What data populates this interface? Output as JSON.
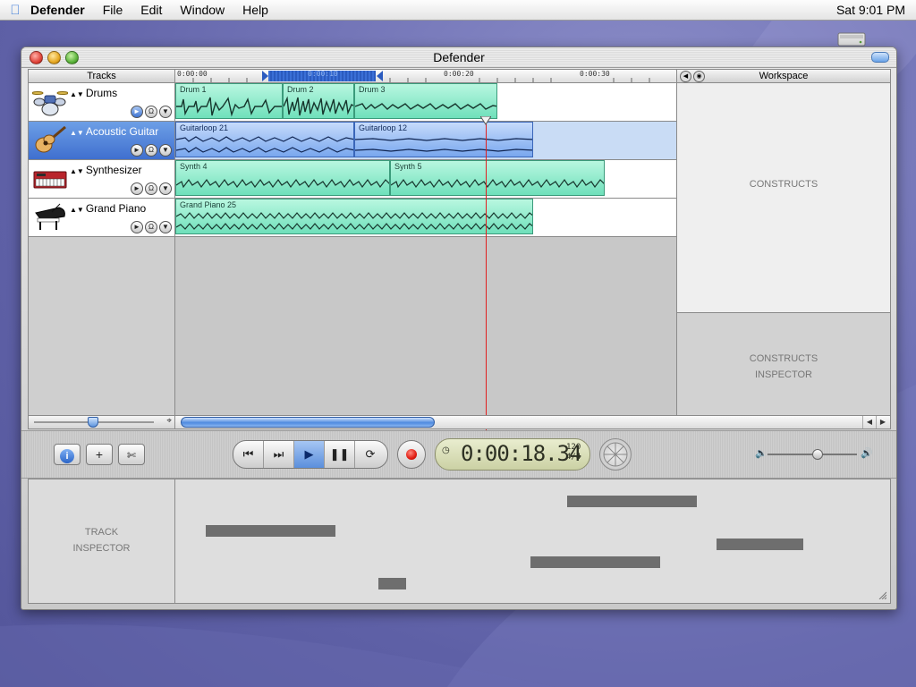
{
  "menubar": {
    "app_name": "Defender",
    "items": [
      "File",
      "Edit",
      "Window",
      "Help"
    ],
    "clock": "Sat 9:01 PM"
  },
  "window": {
    "title": "Defender"
  },
  "tracks_panel": {
    "header": "Tracks",
    "tracks": [
      {
        "name": "Drums",
        "icon": "drum-kit-icon",
        "selected": false
      },
      {
        "name": "Acoustic Guitar",
        "icon": "guitar-icon",
        "selected": true
      },
      {
        "name": "Synthesizer",
        "icon": "keyboard-synth-icon",
        "selected": false
      },
      {
        "name": "Grand Piano",
        "icon": "grand-piano-icon",
        "selected": false
      }
    ]
  },
  "timeline": {
    "ruler_labels": [
      "0:00:00",
      "0:00:10",
      "0:00:20",
      "0:00:30"
    ],
    "regions": [
      {
        "track": 0,
        "label": "Drum 1",
        "color": "green"
      },
      {
        "track": 0,
        "label": "Drum 2",
        "color": "green"
      },
      {
        "track": 0,
        "label": "Drum 3",
        "color": "green"
      },
      {
        "track": 1,
        "label": "Guitarloop 21",
        "color": "blue"
      },
      {
        "track": 1,
        "label": "Guitarloop 12",
        "color": "blue"
      },
      {
        "track": 2,
        "label": "Synth 4",
        "color": "green"
      },
      {
        "track": 2,
        "label": "Synth 5",
        "color": "green"
      },
      {
        "track": 3,
        "label": "Grand Piano 25",
        "color": "green"
      }
    ]
  },
  "workspace": {
    "header": "Workspace",
    "constructs_label": "CONSTRUCTS",
    "constructs_inspector_label_line1": "CONSTRUCTS",
    "constructs_inspector_label_line2": "INSPECTOR"
  },
  "transport": {
    "time_display": "0:00:18.34",
    "tempo": "120",
    "time_signature": "4/4"
  },
  "track_inspector": {
    "label_line1": "TRACK",
    "label_line2": "INSPECTOR"
  },
  "colors": {
    "region_green": "#6fe0bb",
    "region_blue": "#79a7ee",
    "selection_blue": "#3f6fcf",
    "playhead_red": "#e02020",
    "record_red": "#e01b10"
  }
}
